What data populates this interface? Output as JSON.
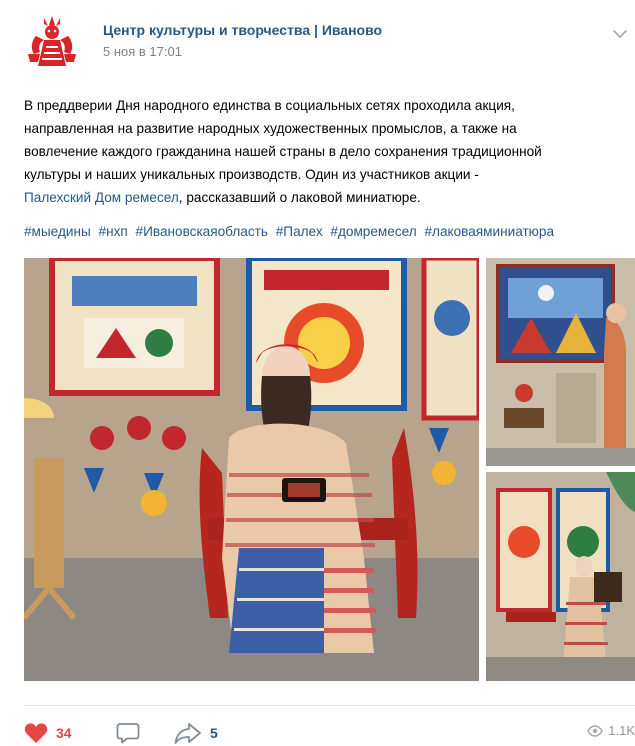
{
  "post": {
    "author": "Центр культуры и творчества | Иваново",
    "date": "5 ноя в 17:01",
    "text_lines": [
      "В преддверии Дня народного единства в социальных сетях проходила акция,",
      "направленная на развитие народных художественных промыслов, а также на",
      "вовлечение каждого гражданина нашей страны в дело сохранения традиционной",
      "культуры и наших уникальных производств. Один из участников акции -"
    ],
    "link_text": "Палехский Дом ремесел",
    "text_after_link": ", рассказавший о лаковой миниатюре.",
    "hashtags": [
      "#мыедины",
      "#нхп",
      "#Ивановскаяобласть",
      "#Палех",
      "#домремесел",
      "#лаковаяминиатюра"
    ]
  },
  "actions": {
    "likes": "34",
    "shares": "5",
    "views": "1.1K"
  },
  "colors": {
    "link": "#2a5885",
    "like": "#e64646",
    "muted": "#828282",
    "logo_red": "#d9252a"
  },
  "icons": [
    "logo-icon",
    "chevron-down-icon",
    "heart-icon",
    "comment-icon",
    "share-icon",
    "eye-icon"
  ]
}
